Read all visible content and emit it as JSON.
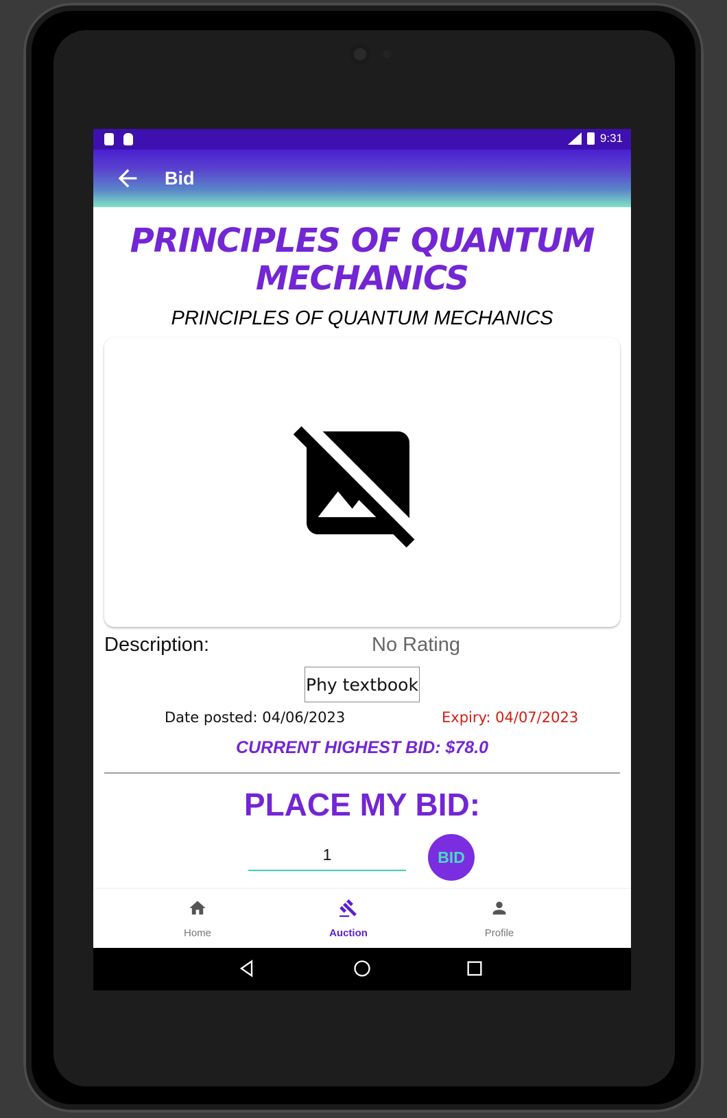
{
  "status_bar": {
    "time": "9:31"
  },
  "app_bar": {
    "title": "Bid"
  },
  "item": {
    "title": "PRINCIPLES OF QUANTUM MECHANICS",
    "subtitle": "PRINCIPLES OF QUANTUM MECHANICS",
    "description_label": "Description:",
    "rating": "No Rating",
    "description": "Phy textbook",
    "date_posted": "Date posted: 04/06/2023",
    "expiry": "Expiry: 04/07/2023",
    "current_highest_bid": "CURRENT HIGHEST BID: $78.0"
  },
  "bid_form": {
    "heading": "PLACE MY BID:",
    "amount_value": "1",
    "button_label": "BID"
  },
  "bottom_nav": {
    "items": [
      {
        "label": "Home",
        "icon": "home-icon"
      },
      {
        "label": "Auction",
        "icon": "gavel-icon",
        "active": true
      },
      {
        "label": "Profile",
        "icon": "person-icon"
      }
    ]
  },
  "colors": {
    "accent": "#7326d4",
    "status_bar": "#3e10b0",
    "expiry_red": "#d41d12",
    "teal": "#3ad1b4"
  }
}
